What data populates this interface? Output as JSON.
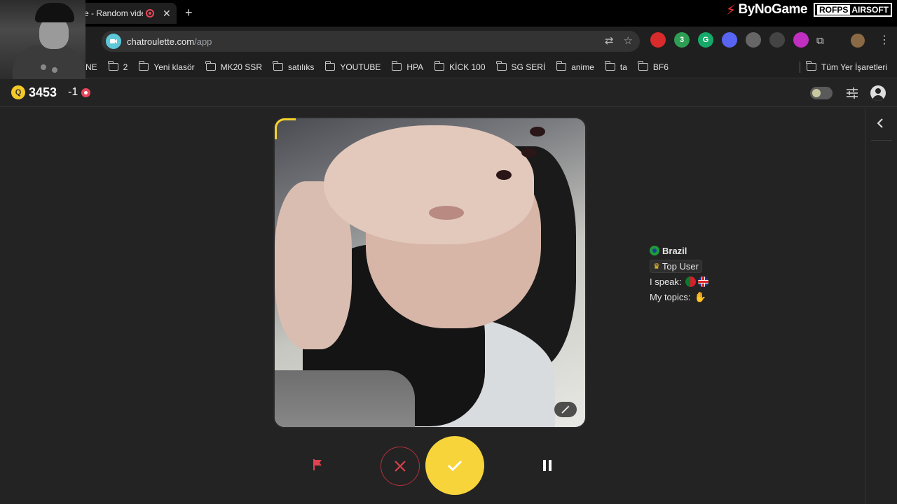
{
  "browser": {
    "tab_title": "e - Random vide",
    "new_tab_icon": "plus-icon",
    "url_host": "chatroulette.com",
    "url_path": "/app",
    "brands": {
      "bynogame": "ByNoGame",
      "rofps_left": "ROFPS",
      "rofps_right": "AIRSOFT"
    },
    "extensions": [
      {
        "name": "red-shield-ext",
        "color": "#d92b2b",
        "label": ""
      },
      {
        "name": "green-badge-ext",
        "color": "#2f9e55",
        "label": "3"
      },
      {
        "name": "grammarly-ext",
        "color": "#15a869",
        "label": "G"
      },
      {
        "name": "discord-ext",
        "color": "#5865f2",
        "label": ""
      },
      {
        "name": "shield-ext",
        "color": "#666666",
        "label": ""
      },
      {
        "name": "diamond-ext",
        "color": "#444444",
        "label": ""
      },
      {
        "name": "magenta-ext",
        "color": "#c02fbf",
        "label": ""
      }
    ]
  },
  "bookmarks": {
    "items": [
      "NE",
      "2",
      "Yeni klasör",
      "MK20 SSR",
      "satılıks",
      "YOUTUBE",
      "HPA",
      "KİCK 100",
      "SG SERİ",
      "anime",
      "ta",
      "BF6"
    ],
    "all_bookmarks": "Tüm Yer İşaretleri"
  },
  "app": {
    "coins": "3453",
    "coin_symbol": "Q",
    "delta": "-1",
    "partner": {
      "country": "Brazil",
      "badge": "Top User",
      "speak_label": "I speak:",
      "topics_label": "My topics:"
    },
    "colors": {
      "accent": "#f7d43a",
      "skip": "#b3313b",
      "background": "#232323"
    }
  }
}
